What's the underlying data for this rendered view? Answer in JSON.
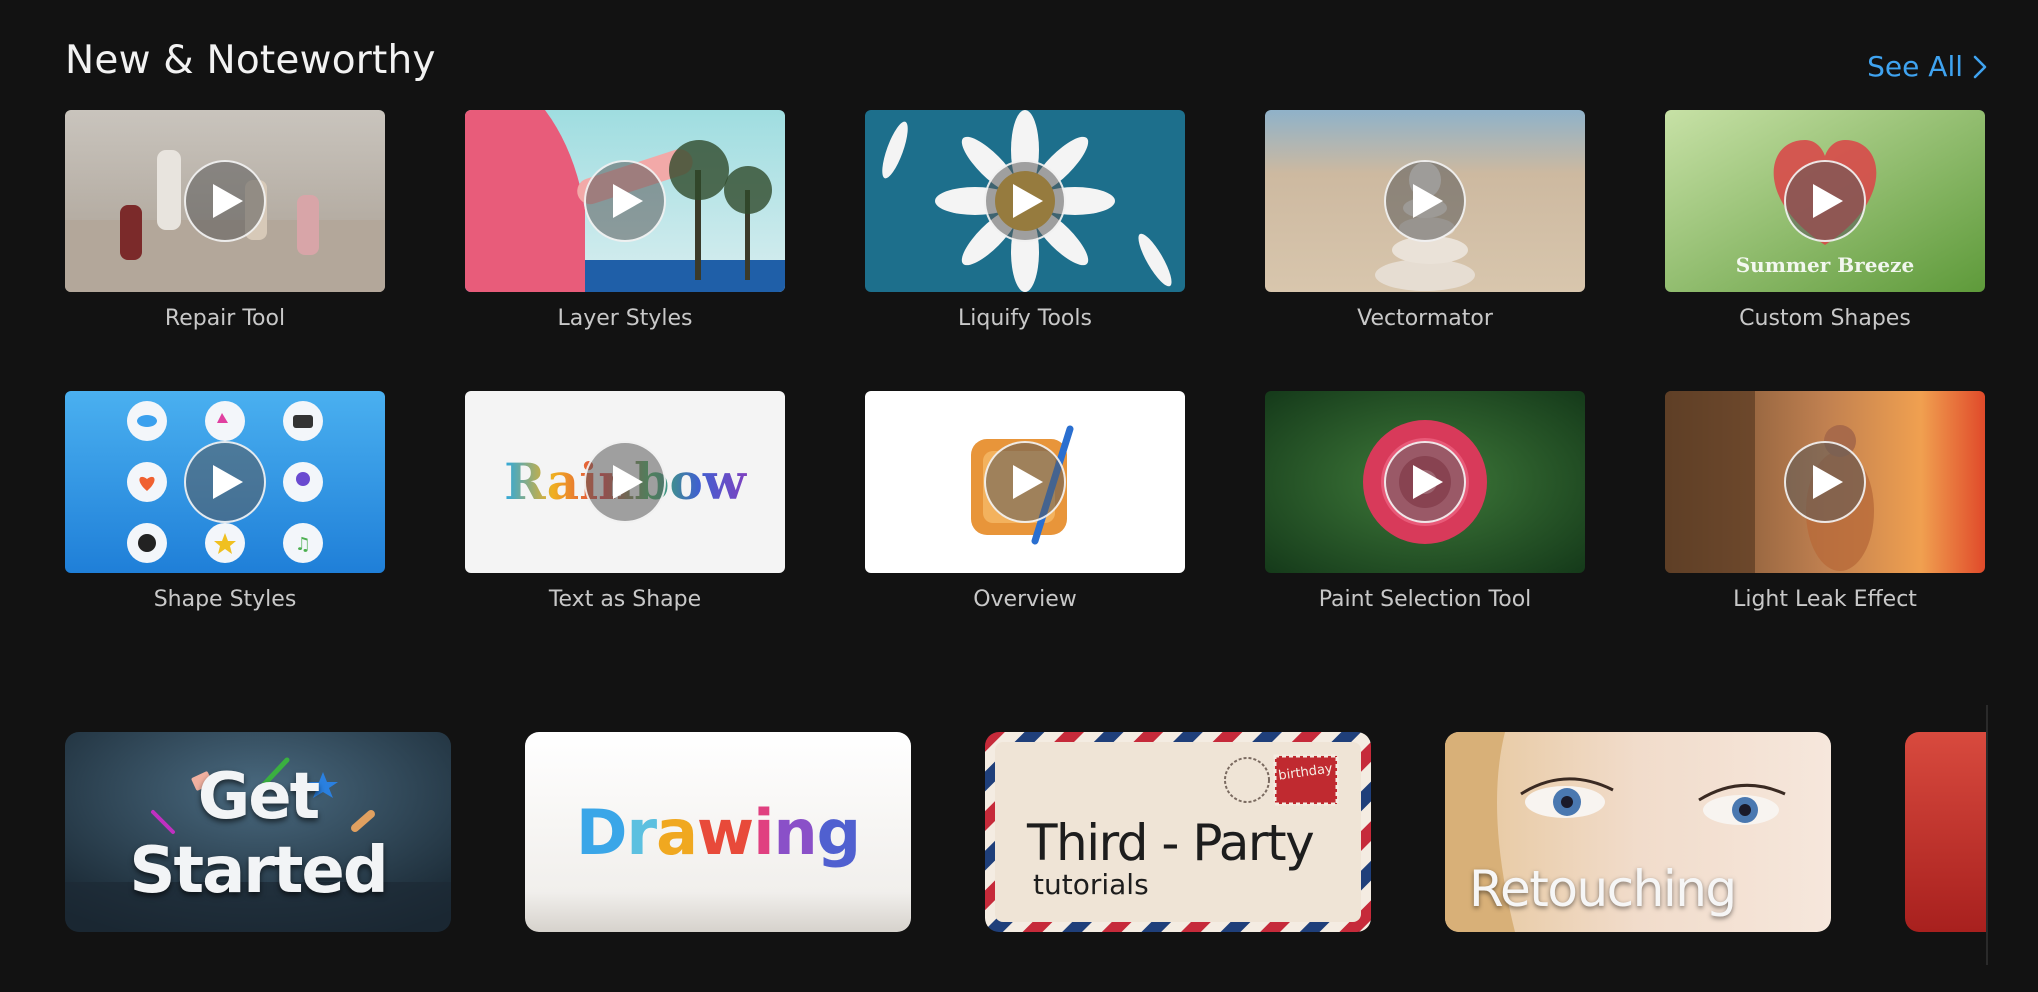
{
  "section": {
    "title": "New & Noteworthy",
    "see_all_label": "See All"
  },
  "videos": [
    {
      "label": "Repair Tool"
    },
    {
      "label": "Layer Styles"
    },
    {
      "label": "Liquify Tools"
    },
    {
      "label": "Vectormator"
    },
    {
      "label": "Custom Shapes",
      "thumb_text": "Summer Breeze"
    },
    {
      "label": "Shape Styles"
    },
    {
      "label": "Text as Shape",
      "thumb_text": "Rainbow"
    },
    {
      "label": "Overview"
    },
    {
      "label": "Paint Selection Tool"
    },
    {
      "label": "Light Leak Effect"
    }
  ],
  "banners": {
    "get_started": {
      "title": "Get Started"
    },
    "drawing": {
      "title": "Drawing"
    },
    "third_party": {
      "title": "Third - Party",
      "subtitle": "tutorials",
      "stamp_text": "birthday"
    },
    "retouching": {
      "title": "Retouching"
    }
  },
  "colors": {
    "background": "#121212",
    "link": "#3fa3f0",
    "label": "#c8c8c8"
  }
}
